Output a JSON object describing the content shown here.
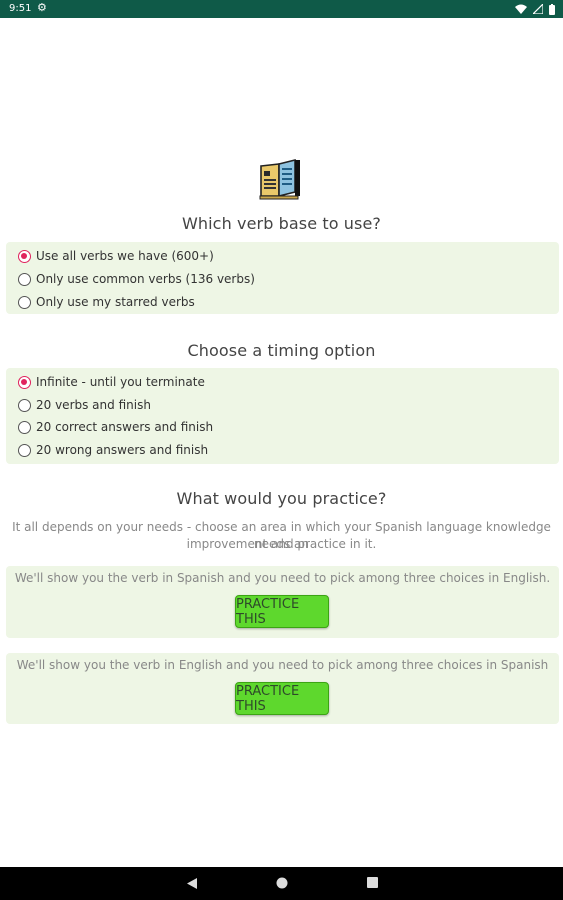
{
  "status": {
    "time": "9:51"
  },
  "verb_base": {
    "heading": "Which verb base to use?",
    "options": [
      {
        "label": "Use all verbs we have (600+)",
        "checked": true
      },
      {
        "label": "Only use common verbs (136 verbs)",
        "checked": false
      },
      {
        "label": "Only use my starred verbs",
        "checked": false
      }
    ]
  },
  "timing": {
    "heading": "Choose a timing option",
    "options": [
      {
        "label": "Infinite - until you terminate",
        "checked": true
      },
      {
        "label": "20 verbs and finish",
        "checked": false
      },
      {
        "label": "20 correct answers and finish",
        "checked": false
      },
      {
        "label": "20 wrong answers and finish",
        "checked": false
      }
    ]
  },
  "practice": {
    "heading": "What would you practice?",
    "description_line1": "It all depends on your needs - choose an area in which your Spanish language knowledge needs an",
    "description_line2": "improvement and practice in it.",
    "cards": [
      {
        "text": "We'll show you the verb in Spanish and you need to pick among three choices in English.",
        "button": "PRACTICE THIS"
      },
      {
        "text": "We'll show you the verb in English and you need to pick among three choices in Spanish",
        "button": "PRACTICE THIS"
      }
    ]
  },
  "colors": {
    "status_bar": "#0f5a48",
    "panel": "#eef6e5",
    "radio_checked": "#e0245e",
    "button": "#5ed82d"
  }
}
